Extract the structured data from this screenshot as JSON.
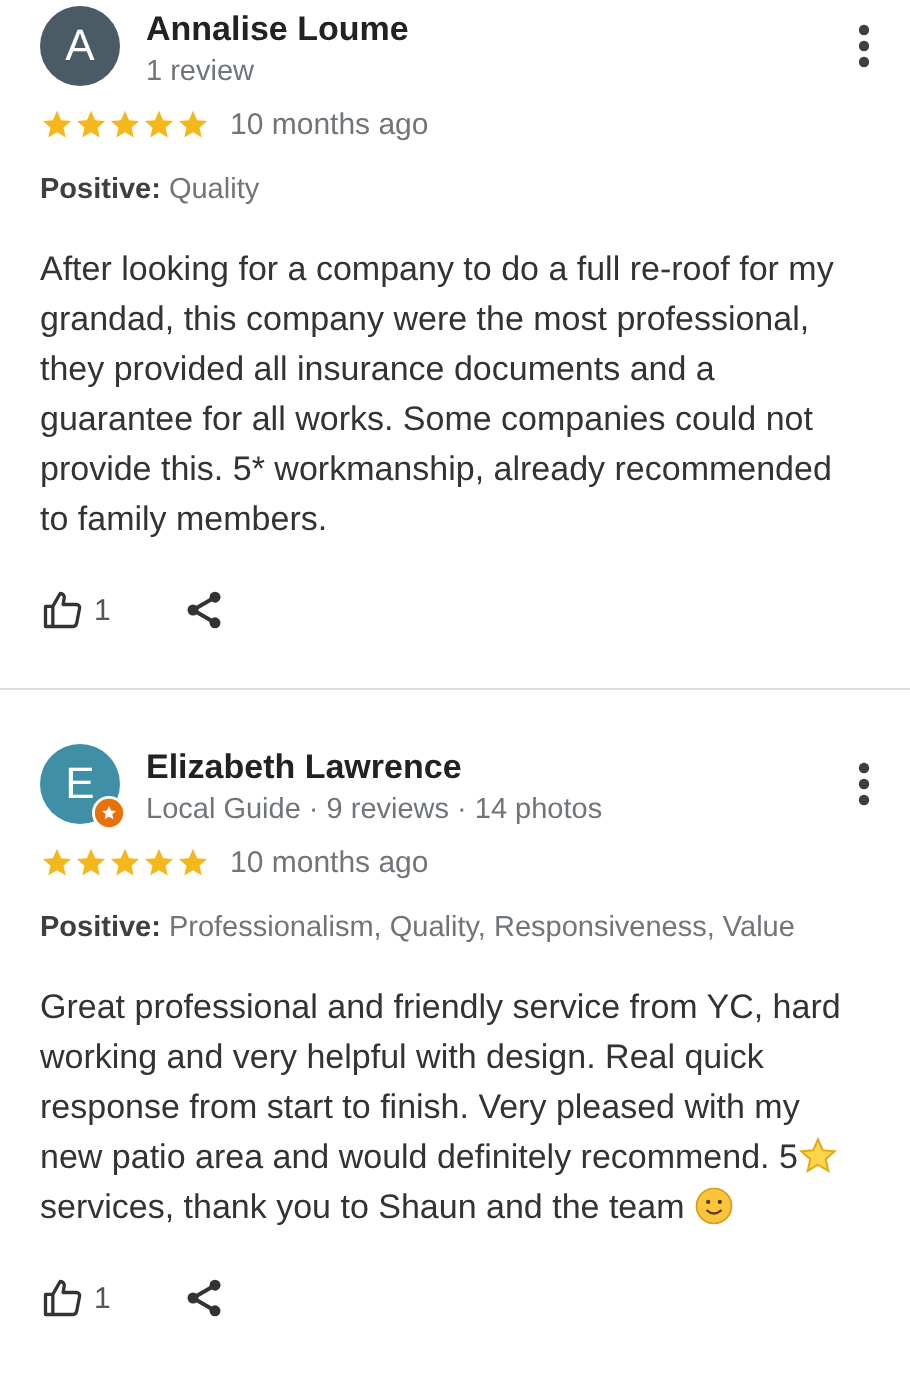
{
  "reviews": [
    {
      "initial": "A",
      "color": "#4a5b66",
      "local_guide": false,
      "name": "Annalise Loume",
      "meta": "1 review",
      "stars": 5,
      "time": "10 months ago",
      "positive_label": "Positive:",
      "positive": "Quality",
      "body": [
        {
          "kind": "text",
          "text": "After looking for a company to do a full re-roof for my grandad, this company were the most professional, they provided all insurance documents and a guarantee for all works. Some companies could not provide this. 5* workmanship, already recommended to family members."
        }
      ],
      "likes": "1"
    },
    {
      "initial": "E",
      "color": "#3f8fa6",
      "local_guide": true,
      "name": "Elizabeth Lawrence",
      "meta": "Local Guide · 9 reviews · 14 photos",
      "stars": 5,
      "time": "10 months ago",
      "positive_label": "Positive:",
      "positive": "Professionalism, Quality, Responsiveness, Value",
      "body": [
        {
          "kind": "text",
          "text": "Great professional and friendly service from YC, hard working and very helpful with design. Real quick response from start to finish. Very pleased with my"
        },
        {
          "kind": "text-star",
          "text": "new patio area and would definitely recommend. 5"
        },
        {
          "kind": "text-smile",
          "text": "services, thank you to Shaun and the team"
        }
      ],
      "likes": "1"
    }
  ]
}
